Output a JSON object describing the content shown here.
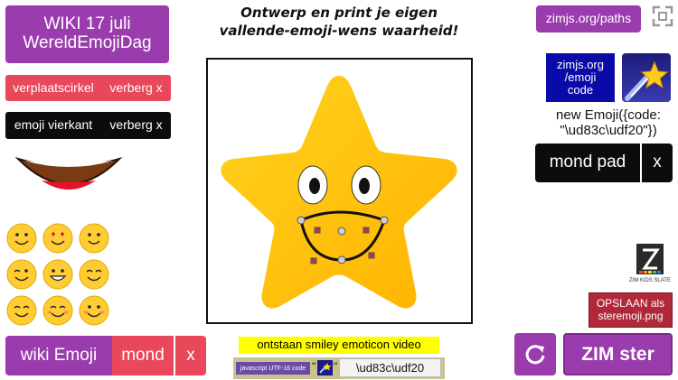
{
  "title": {
    "line1": "Ontwerp en print je eigen",
    "line2": "vallende-emoji-wens waarheid!"
  },
  "left_panel": {
    "wiki_button": {
      "line1": "WIKI 17 juli",
      "line2": "WereldEmojiDag"
    },
    "circle_row": {
      "move_label": "verplaatscirkel",
      "hide_label": "verberg x"
    },
    "square_row": {
      "emoji_label": "emoji vierkant",
      "hide_label": "verberg x"
    },
    "mouth_icon": "mouth-icon",
    "emoji_grid": [
      "smile",
      "heart-eyes",
      "grin",
      "smirk-wink",
      "big-grin",
      "happy-closed",
      "relieved",
      "content",
      "blush"
    ]
  },
  "bottom_left": {
    "wiki_label": "wiki Emoji",
    "mouth_label": "mond",
    "close_label": "x"
  },
  "center": {
    "star_icon": "star-emoji-icon",
    "video_label": "ontstaan smiley emoticon video",
    "code_input": {
      "tag": "javascript UTF-16 code",
      "quote_open": "\"",
      "quote_close": "\"",
      "value": "\\ud83c\\udf20"
    }
  },
  "right_panel": {
    "paths_link": "zimjs.org/paths",
    "fullscreen_icon": "fullscreen-icon",
    "code_link": {
      "line1": "zimjs.org",
      "line2": "/emoji",
      "line3": "code"
    },
    "shooting_star_icon": "shooting-star-icon",
    "code_text": {
      "line1": "new Emoji({code:",
      "line2": "\"\\ud83c\\udf20\"})"
    },
    "mouth_path": {
      "label": "mond pad",
      "close": "x"
    },
    "logo": {
      "caption": "ZIM KiDS SLATE"
    },
    "save_button": {
      "line1": "OPSLAAN als",
      "line2": "steremoji.png"
    },
    "reload_icon": "reload-icon",
    "star_button": "ZIM ster"
  },
  "colors": {
    "purple": "#9b3cae",
    "red": "#e9475a",
    "black": "#0c0c0c",
    "navy": "#0a0aa8",
    "star_yellow": "#ffc61a",
    "video_yellow": "#ffff00"
  }
}
